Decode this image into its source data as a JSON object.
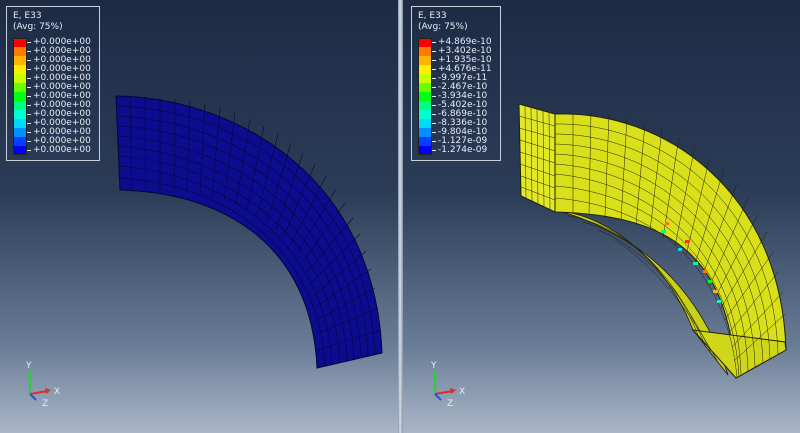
{
  "left_viewport": {
    "legend": {
      "title": "E, E33",
      "subtitle": "(Avg: 75%)",
      "entries": [
        {
          "value": "+0.000e+00",
          "color": "#ff0000"
        },
        {
          "value": "+0.000e+00",
          "color": "#ff7a00"
        },
        {
          "value": "+0.000e+00",
          "color": "#ffb400"
        },
        {
          "value": "+0.000e+00",
          "color": "#ffee00"
        },
        {
          "value": "+0.000e+00",
          "color": "#c8ff00"
        },
        {
          "value": "+0.000e+00",
          "color": "#6aff00"
        },
        {
          "value": "+0.000e+00",
          "color": "#00ff12"
        },
        {
          "value": "+0.000e+00",
          "color": "#00ff80"
        },
        {
          "value": "+0.000e+00",
          "color": "#00ffd0"
        },
        {
          "value": "+0.000e+00",
          "color": "#00d8ff"
        },
        {
          "value": "+0.000e+00",
          "color": "#0090ff"
        },
        {
          "value": "+0.000e+00",
          "color": "#0040ff"
        },
        {
          "value": "+0.000e+00",
          "color": "#0000ee"
        }
      ]
    },
    "model_color": "#0c0c8e",
    "triad": {
      "x": "X",
      "y": "Y",
      "z": "Z"
    }
  },
  "right_viewport": {
    "legend": {
      "title": "E, E33",
      "subtitle": "(Avg: 75%)",
      "entries": [
        {
          "value": "+4.869e-10",
          "color": "#ff0000"
        },
        {
          "value": "+3.402e-10",
          "color": "#ff7a00"
        },
        {
          "value": "+1.935e-10",
          "color": "#ffb400"
        },
        {
          "value": "+4.676e-11",
          "color": "#ffee00"
        },
        {
          "value": "-9.997e-11",
          "color": "#c8ff00"
        },
        {
          "value": "-2.467e-10",
          "color": "#6aff00"
        },
        {
          "value": "-3.934e-10",
          "color": "#00ff12"
        },
        {
          "value": "-5.402e-10",
          "color": "#00ff80"
        },
        {
          "value": "-6.869e-10",
          "color": "#00ffd0"
        },
        {
          "value": "-8.336e-10",
          "color": "#00d8ff"
        },
        {
          "value": "-9.804e-10",
          "color": "#0090ff"
        },
        {
          "value": "-1.127e-09",
          "color": "#0040ff"
        },
        {
          "value": "-1.274e-09",
          "color": "#0000ee"
        }
      ]
    },
    "model_color": "#d9e01a",
    "triad": {
      "x": "X",
      "y": "Y",
      "z": "Z"
    }
  }
}
